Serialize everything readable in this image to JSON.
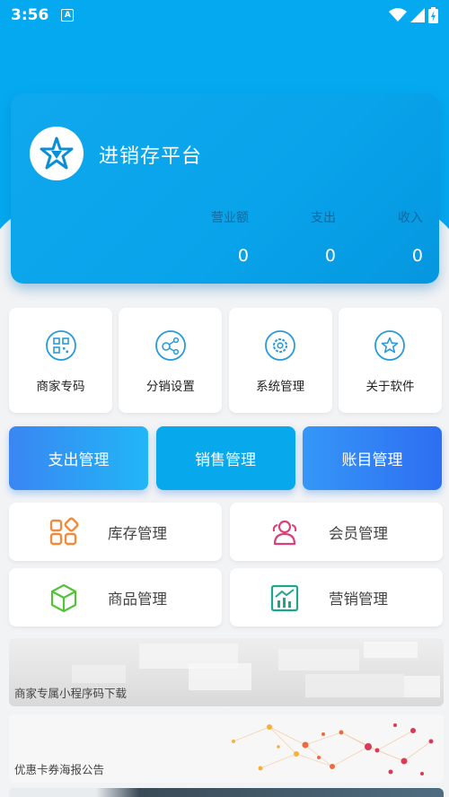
{
  "status_bar": {
    "time": "3:56",
    "notif_letter": "A"
  },
  "header": {
    "title": "进销存平台",
    "stats": [
      {
        "label": "营业额",
        "value": "0"
      },
      {
        "label": "支出",
        "value": "0"
      },
      {
        "label": "收入",
        "value": "0"
      }
    ]
  },
  "quick_tiles": [
    {
      "label": "商家专码",
      "icon": "qr-code-icon"
    },
    {
      "label": "分销设置",
      "icon": "share-nodes-icon"
    },
    {
      "label": "系统管理",
      "icon": "gear-icon"
    },
    {
      "label": "关于软件",
      "icon": "star-icon"
    }
  ],
  "action_buttons": [
    {
      "label": "支出管理"
    },
    {
      "label": "销售管理"
    },
    {
      "label": "账目管理"
    }
  ],
  "menu_items": [
    {
      "label": "库存管理",
      "icon": "grid-blocks-icon",
      "color": "#f08a3c"
    },
    {
      "label": "会员管理",
      "icon": "users-icon",
      "color": "#d9407a"
    },
    {
      "label": "商品管理",
      "icon": "box-icon",
      "color": "#53c33a"
    },
    {
      "label": "营销管理",
      "icon": "chart-icon",
      "color": "#1fa58e"
    }
  ],
  "banners": [
    {
      "label": "商家专属小程序码下载"
    },
    {
      "label": "优惠卡券海报公告"
    }
  ],
  "colors": {
    "primary": "#05a9ef",
    "page_bg": "#f2f3f5"
  }
}
